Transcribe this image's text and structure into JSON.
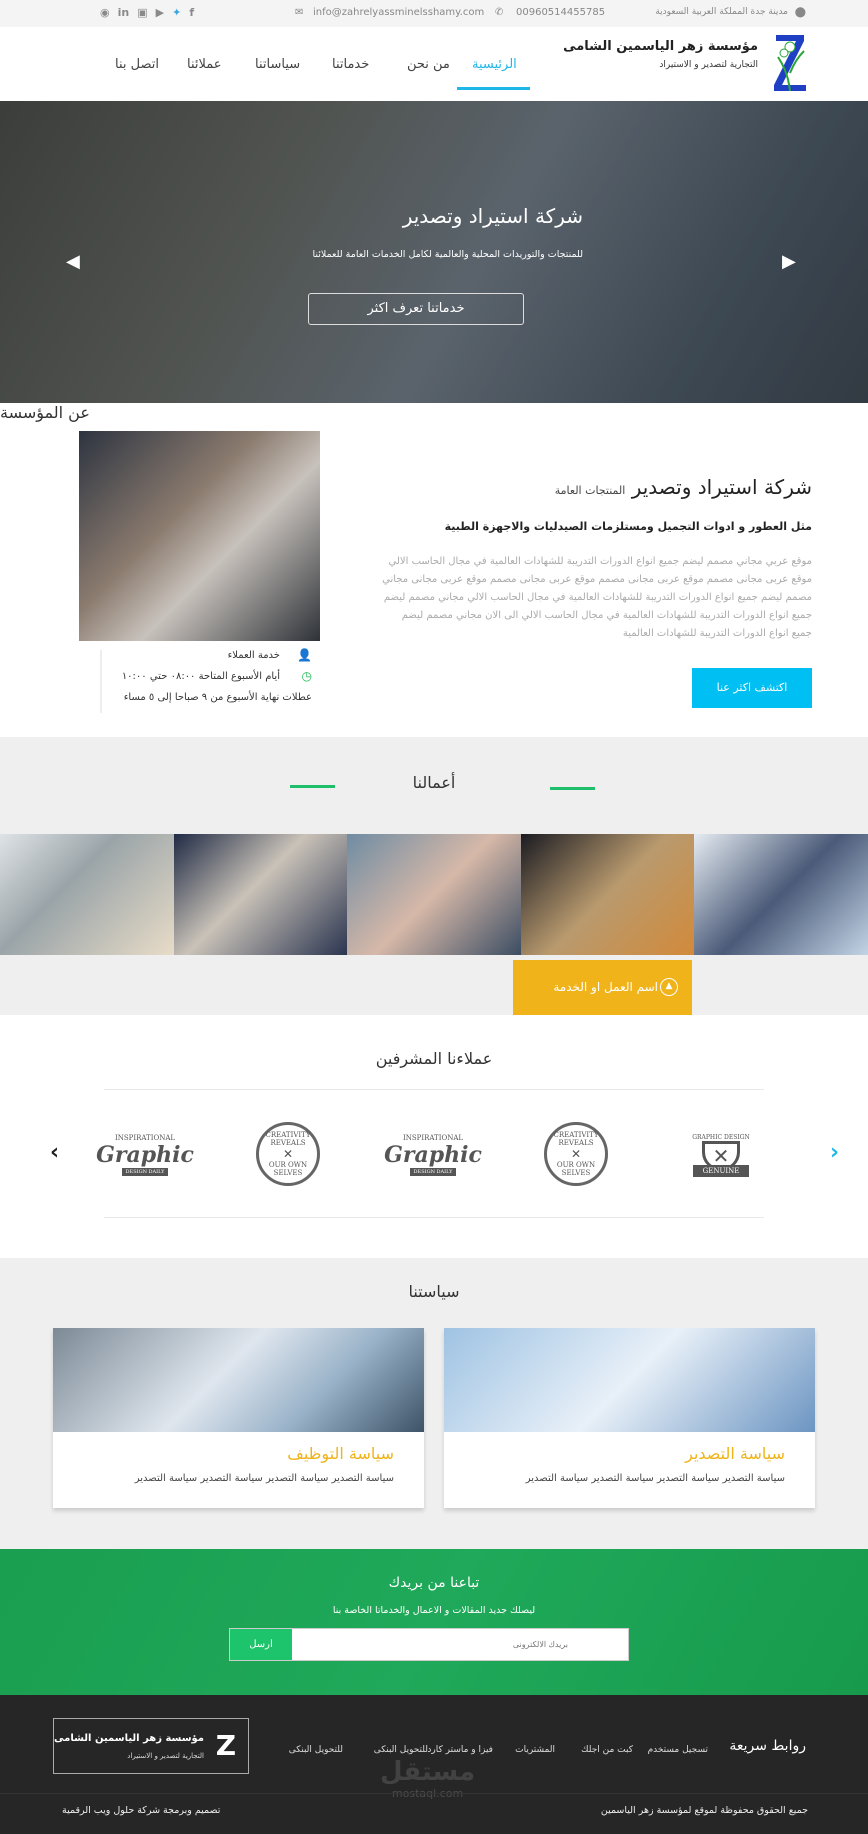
{
  "topbar": {
    "address": "مدينة جدة المملكة العربية السعودية",
    "phone": "00960514455785",
    "email": "info@zahrelyassminelsshamy.com",
    "social": [
      "rss-icon",
      "linkedin-icon",
      "instagram-icon",
      "youtube-icon",
      "twitter-icon",
      "facebook-icon"
    ]
  },
  "header": {
    "logo_line1": "مؤسسة زهر الياسمين الشامى",
    "logo_line2": "التجارية لتصدير و الاستيراد",
    "nav": [
      "الرئيسية",
      "من نحن",
      "خدماتنا",
      "سياساتنا",
      "عملائنا",
      "اتصل بنا"
    ],
    "active": "الرئيسية",
    "accent": "#20b7e8"
  },
  "hero": {
    "title": "شركة استيراد وتصدير",
    "subtitle": "للمنتجات والتوريدات المحلية والعالمية لكامل الخدمات العامة للعملائنا",
    "button": "خدماتنا تعرف اكثر"
  },
  "about": {
    "heading": "عن المؤسسة",
    "title": "شركة استيراد وتصدير",
    "title_small": "المنتجات العامة",
    "subtitle": "مثل العطور و ادوات التجميل ومستلزمات الصيدليات والاجهزة الطبية",
    "paragraph": "موقع عربي مجاني مصمم ليضم جميع انواع الدورات التدريبة للشهادات العالمية  في مجال الحاسب الالي موقع عربى مجانى مصمم موقع عربى مجانى مصمم  موقع عربى مجانى مصمم موقع عربى مجانى مجاني مصمم ليضم جميع انواع الدورات التدريبة للشهادات العالمية  في مجال الحاسب الالي مجاني مصمم ليضم جميع انواع الدورات التدريبة للشهادات العالمية  في مجال الحاسب الالي الى الان مجاني مصمم ليضم جميع انواع الدورات التدريبة للشهادات العالمية",
    "button": "اكتشف اكثر عنا",
    "info": [
      "خدمة العملاء",
      "أيام الأسبوع المتاحة ٠٨:٠٠ حتي ١٠:٠٠",
      "عطلات نهاية الأسبوع من ٩ صباحا إلى ٥ مساء"
    ]
  },
  "works": {
    "title": "أعمالنا",
    "caption": "اسم العمل او الخدمة",
    "caption_color": "#f0b31a"
  },
  "clients": {
    "title": "عملاءنا المشرفين",
    "logos": [
      {
        "main": "Graphic",
        "top": "INSPIRATIONAL",
        "bottom": "DESIGN DAILY"
      },
      {
        "main": "CREATIVITY REVEALS",
        "bottom": "OUR OWN SELVES"
      },
      {
        "main": "Graphic",
        "top": "INSPIRATIONAL",
        "bottom": "DESIGN DAILY"
      },
      {
        "main": "CREATIVITY REVEALS",
        "bottom": "OUR OWN SELVES"
      },
      {
        "main": "GENUINE",
        "top": "GRAPHIC DESIGN"
      }
    ]
  },
  "policies": {
    "title": "سياستنا",
    "cards": [
      {
        "title": "سياسة التصدير",
        "text": "سياسة التصدير سياسة التصدير  سياسة التصدير  سياسة التصدير"
      },
      {
        "title": "سياسة التوظيف",
        "text": "سياسة التصدير سياسة التصدير  سياسة التصدير  سياسة التصدير"
      }
    ]
  },
  "newsletter": {
    "title": "تباعنا من بريدك",
    "subtitle": "ليصلك جديد المقالات و الاعمال والخدماتا الخاصة بنا",
    "placeholder": "بريدك الالكترونى",
    "button": "ارسل"
  },
  "footer": {
    "quick_links_title": "روابط سريعة",
    "links": [
      "تسجيل مستخدم",
      "كبت من اجلك",
      "المشتريات",
      "فيزا و ماستر كارد",
      "للتحويل البنكى",
      "للتحويل البنكى"
    ],
    "logo_line1": "مؤسسة زهر الياسمين الشامى",
    "logo_line2": "التجارية لتصدير و الاستيراد",
    "copyright": "جميع الحقوق محفوظة لموقع لمؤسسة زهر الياسمين",
    "credit": "تصميم وبرمجة شركة حلول ويب الرقمية",
    "watermark_ar": "مستقل",
    "watermark_en": "mostaql.com"
  }
}
